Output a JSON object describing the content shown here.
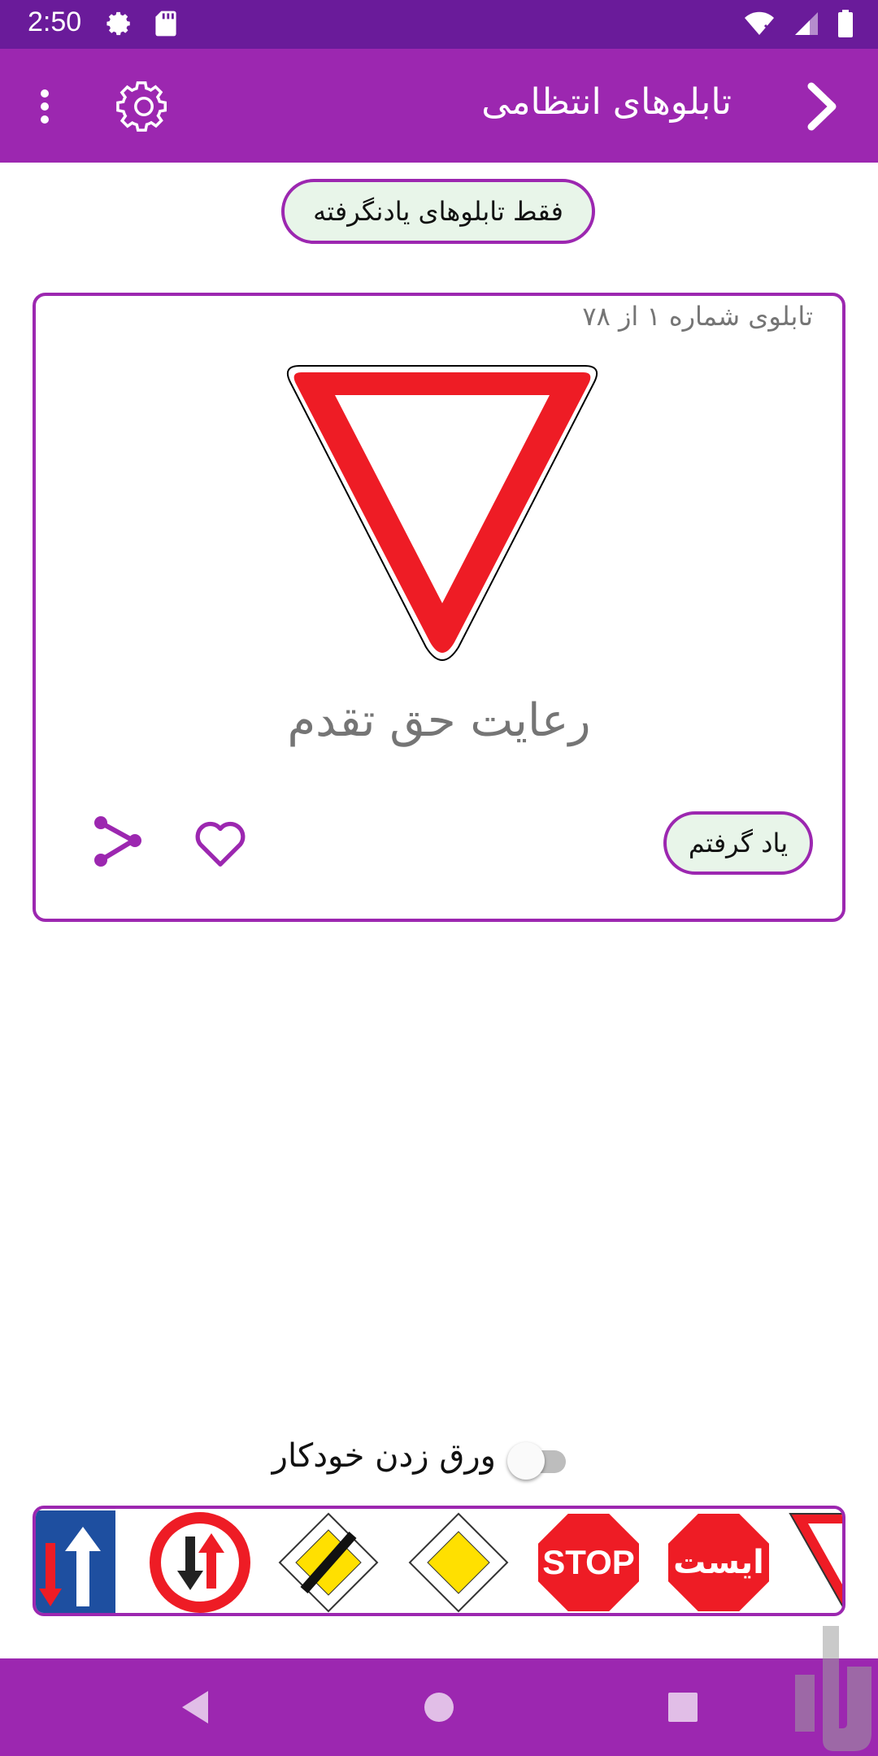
{
  "status_bar": {
    "time": "2:50",
    "icons": [
      "gear-icon",
      "sd-card-icon",
      "wifi-icon",
      "signal-icon",
      "battery-icon"
    ]
  },
  "app_bar": {
    "title": "تابلوهای انتظامی",
    "icons": [
      "chevron-right-icon",
      "settings-icon",
      "more-vert-icon"
    ]
  },
  "filter": {
    "label": "فقط تابلوهای یادنگرفته"
  },
  "card": {
    "counter": "تابلوی شماره ۱ از ۷۸",
    "sign_name": "رعایت حق تقدم",
    "learned_label": "یاد گرفتم",
    "icons": [
      "heart-icon",
      "share-icon"
    ]
  },
  "auto_flip": {
    "label": "ورق زدن خودکار",
    "enabled": false
  },
  "thumbnails": {
    "items": [
      {
        "name": "one-way-priority-sign-partial"
      },
      {
        "name": "priority-oncoming-sign"
      },
      {
        "name": "end-of-priority-road-sign"
      },
      {
        "name": "priority-road-sign"
      },
      {
        "name": "stop-sign",
        "text": "STOP"
      },
      {
        "name": "stop-sign-persian",
        "text": "ایست"
      },
      {
        "name": "yield-sign-partial"
      }
    ]
  },
  "colors": {
    "primary": "#9c27b0",
    "primary_dark": "#6a1b9a",
    "sign_red": "#ee1c25",
    "button_bg": "#e8f5e9"
  }
}
